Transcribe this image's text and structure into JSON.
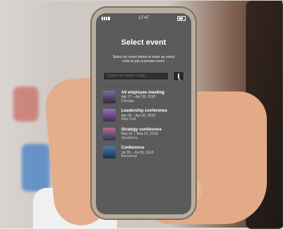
{
  "status_bar": {
    "time": "17:47"
  },
  "screen": {
    "title": "Select event",
    "subtitle_line1": "Select an event below or enter an event",
    "subtitle_line2": "code to join a private event.",
    "search": {
      "placeholder": "Enter an event code..."
    }
  },
  "events": [
    {
      "name": "All employee meeting",
      "dates": "Apr 27 – Apr 28, 2018",
      "location": "Chicago"
    },
    {
      "name": "Leadership conference",
      "dates": "Apr 06 – Apr 06, 2018",
      "location": "New York"
    },
    {
      "name": "Strategy conference",
      "dates": "May 01 – May 01, 2018",
      "location": "Stockholm"
    },
    {
      "name": "Conference",
      "dates": "Jul 05 – Jul 05, 2018",
      "location": "Barcelona"
    }
  ]
}
